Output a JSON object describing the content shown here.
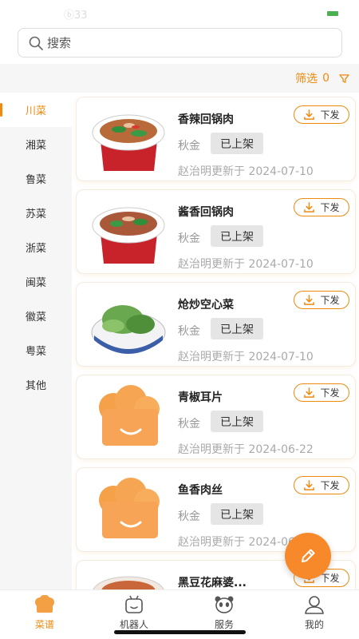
{
  "status_bar": {
    "text": "ⓑ33"
  },
  "search": {
    "placeholder": "搜索"
  },
  "filter": {
    "label": "筛选",
    "count": "0"
  },
  "sidebar": {
    "items": [
      {
        "label": "川菜",
        "active": true
      },
      {
        "label": "湘菜"
      },
      {
        "label": "鲁菜"
      },
      {
        "label": "苏菜"
      },
      {
        "label": "浙菜"
      },
      {
        "label": "闽菜"
      },
      {
        "label": "徽菜"
      },
      {
        "label": "粤菜"
      },
      {
        "label": "其他"
      }
    ]
  },
  "recipes": [
    {
      "name": "香辣回锅肉",
      "author": "秋金",
      "status": "已上架",
      "update": "赵治明更新于 2024-07-10",
      "button": "下发",
      "image": "dish-photo"
    },
    {
      "name": "酱香回锅肉",
      "author": "秋金",
      "status": "已上架",
      "update": "赵治明更新于 2024-07-10",
      "button": "下发",
      "image": "dish-photo"
    },
    {
      "name": "炝炒空心菜",
      "author": "秋金",
      "status": "已上架",
      "update": "赵治明更新于 2024-07-10",
      "button": "下发",
      "image": "dish-photo"
    },
    {
      "name": "青椒耳片",
      "author": "秋金",
      "status": "已上架",
      "update": "赵治明更新于 2024-06-22",
      "button": "下发",
      "image": "chef-hat-placeholder"
    },
    {
      "name": "鱼香肉丝",
      "author": "秋金",
      "status": "已上架",
      "update": "赵治明更新于 2024-06-22",
      "button": "下发",
      "image": "chef-hat-placeholder"
    },
    {
      "name": "黑豆花麻婆...",
      "author": "",
      "status": "",
      "update": "",
      "button": "下发",
      "image": "dish-photo"
    }
  ],
  "tabbar": {
    "tabs": [
      {
        "label": "菜谱",
        "icon": "chef-hat-icon",
        "active": true
      },
      {
        "label": "机器人",
        "icon": "robot-icon"
      },
      {
        "label": "服务",
        "icon": "panda-icon"
      },
      {
        "label": "我的",
        "icon": "user-icon"
      }
    ]
  },
  "colors": {
    "accent": "#ee8a10",
    "fab": "#f7892a",
    "status_bg": "#e5e5e5"
  }
}
